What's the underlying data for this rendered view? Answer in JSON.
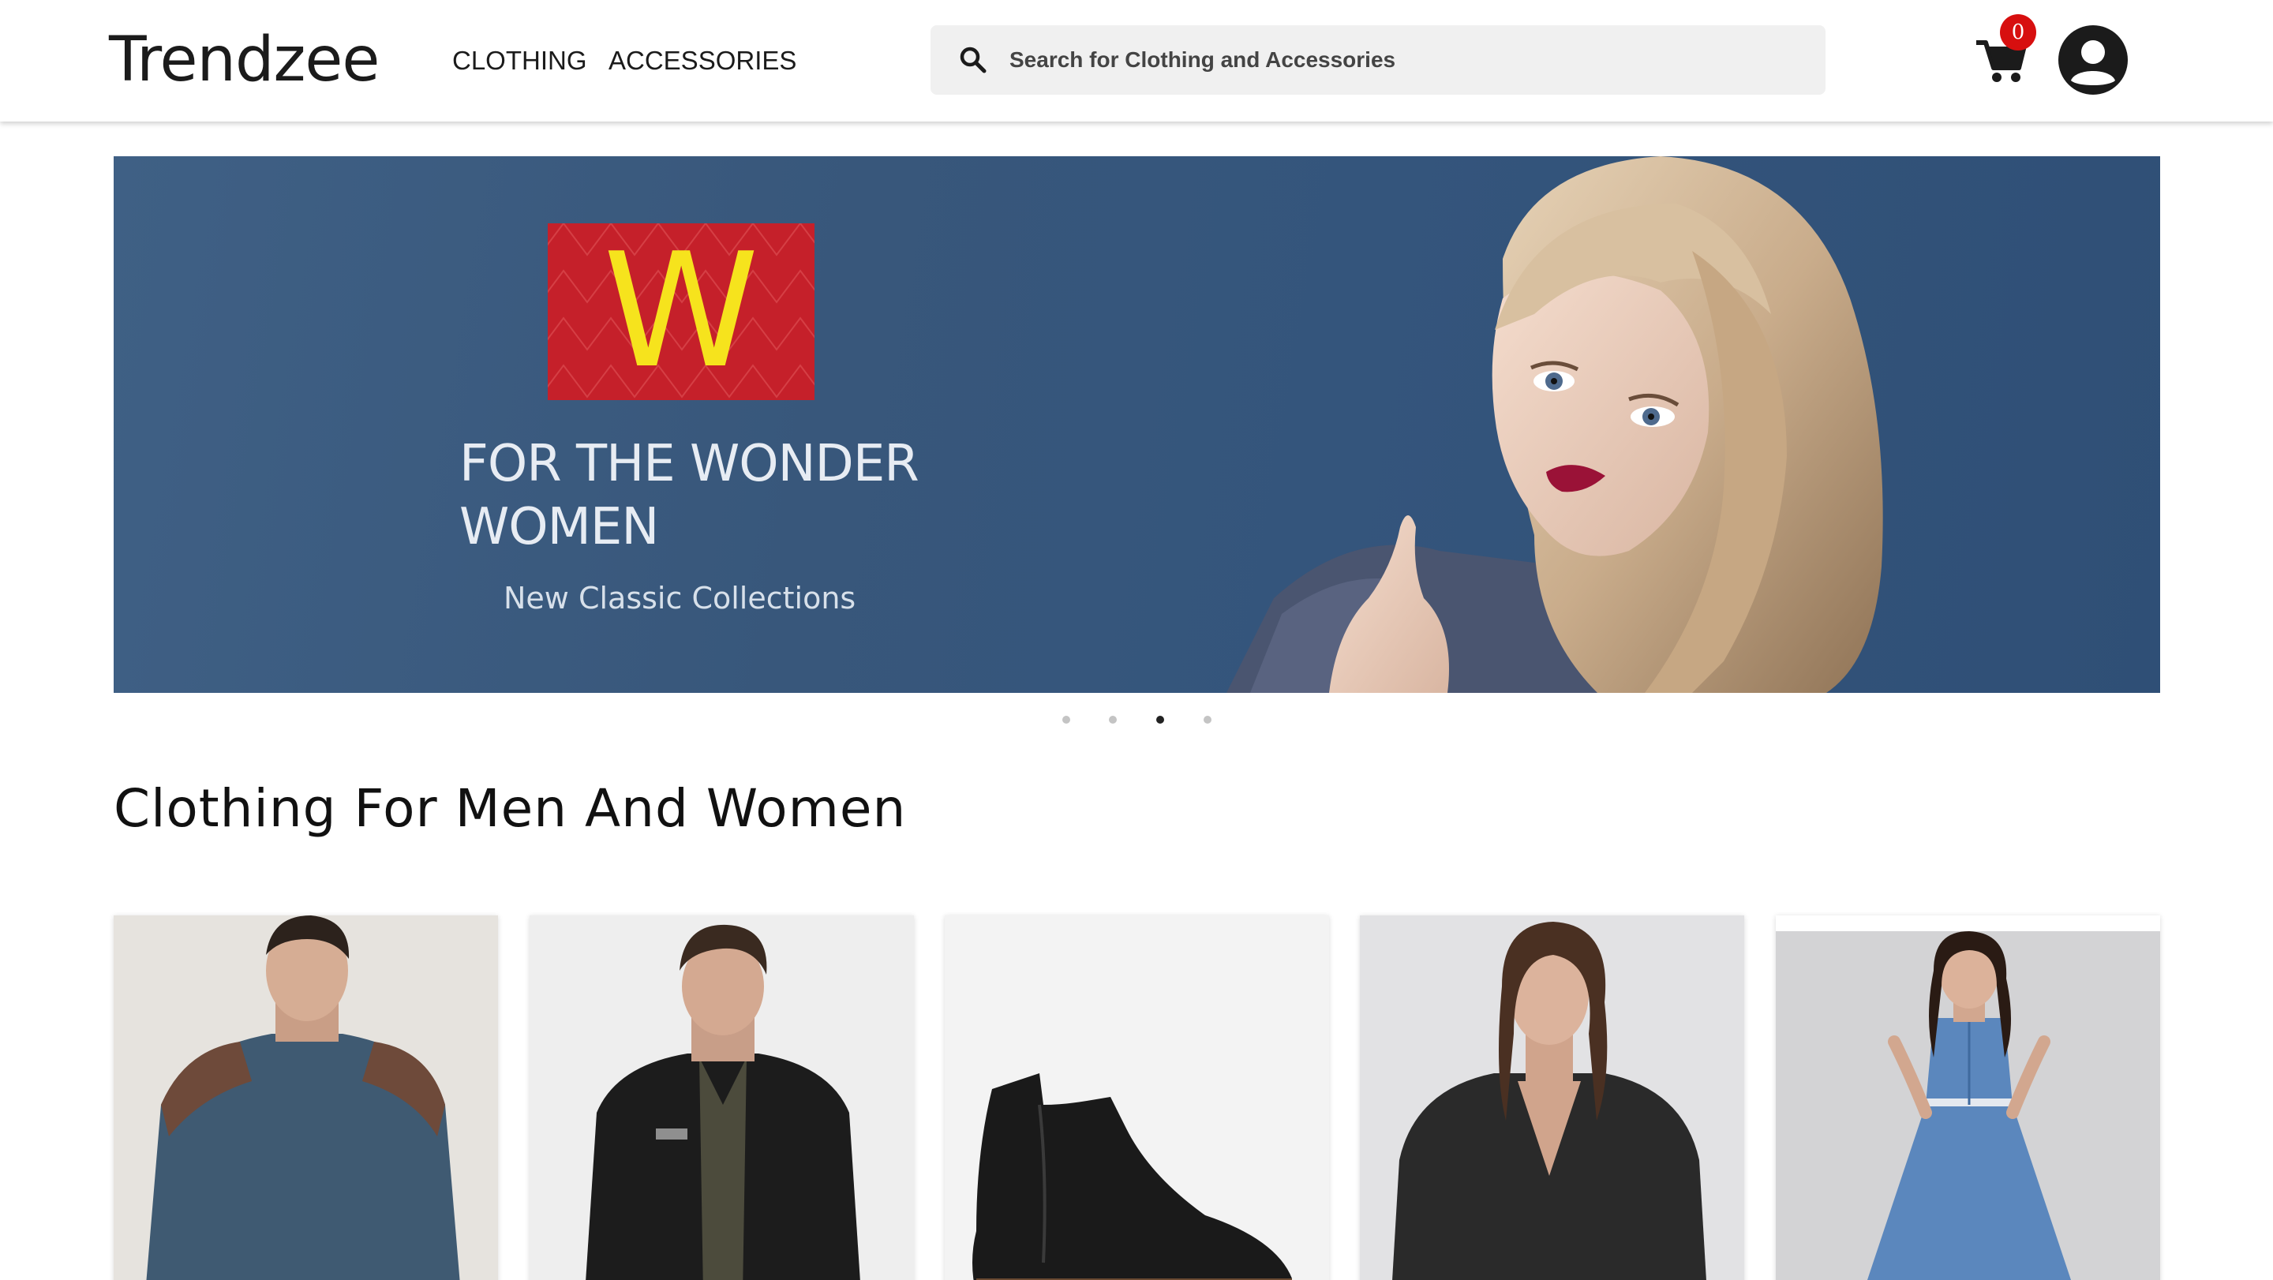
{
  "header": {
    "logo": "Trendzee",
    "nav": [
      {
        "label": "CLOTHING"
      },
      {
        "label": "ACCESSORIES"
      }
    ],
    "search": {
      "placeholder": "Search for Clothing and Accessories",
      "icon": "search-icon"
    },
    "cart": {
      "count": "0",
      "icon": "cart-icon"
    },
    "account": {
      "icon": "user-avatar-icon"
    }
  },
  "banner": {
    "logo_letter": "W",
    "title_line1": "FOR THE WONDER",
    "title_line2": "WOMEN",
    "subtitle": "New Classic Collections",
    "slides": 4,
    "active_slide": 3
  },
  "section": {
    "title": "Clothing For Men And Women"
  },
  "products": [
    {
      "image": "man-blue-sweater"
    },
    {
      "image": "man-black-jacket"
    },
    {
      "image": "black-leather-boot"
    },
    {
      "image": "woman-leather-jacket"
    },
    {
      "image": "woman-denim-dress"
    }
  ],
  "colors": {
    "banner_bg": "#38577b",
    "w_logo_bg": "#c5202a",
    "w_logo_letter": "#f6e31d",
    "cart_badge": "#d70f0f"
  }
}
